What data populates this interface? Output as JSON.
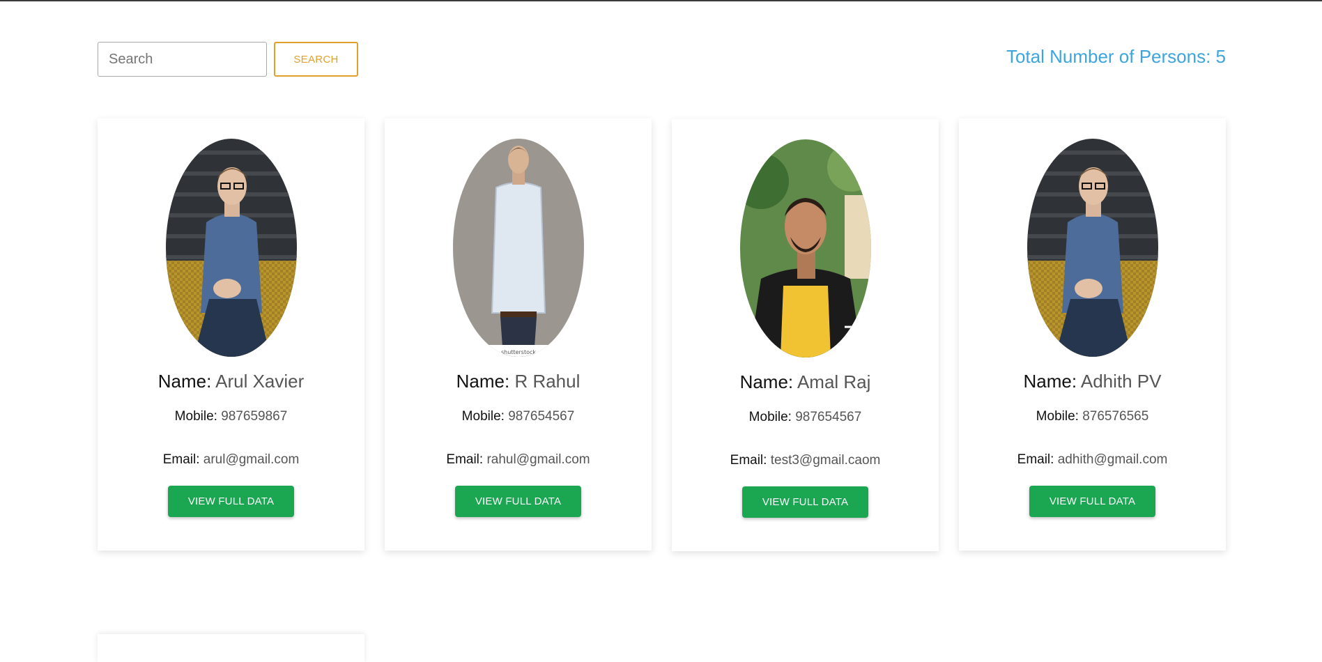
{
  "search": {
    "placeholder": "Search",
    "value": "",
    "button_label": "SEARCH"
  },
  "summary": {
    "total_label": "Total Number of Persons: 5"
  },
  "colors": {
    "accent_orange": "#e0a02a",
    "accent_blue": "#3da5de",
    "button_green": "#1ba651"
  },
  "field_labels": {
    "name": "Name:",
    "mobile": "Mobile:",
    "email": "Email:"
  },
  "persons": [
    {
      "name": "Arul Xavier",
      "mobile": "987659867",
      "email": "arul@gmail.com",
      "button_label": "VIEW FULL DATA",
      "photo": "man-glasses-blue-shirt-photo"
    },
    {
      "name": "R Rahul",
      "mobile": "987654567",
      "email": "rahul@gmail.com",
      "button_label": "VIEW FULL DATA",
      "photo": "man-white-shirt-standing-photo"
    },
    {
      "name": "Amal Raj",
      "mobile": "987654567",
      "email": "test3@gmail.caom",
      "button_label": "VIEW FULL DATA",
      "photo": "man-yellow-hoodie-photo"
    },
    {
      "name": "Adhith PV",
      "mobile": "876576565",
      "email": "adhith@gmail.com",
      "button_label": "VIEW FULL DATA",
      "photo": "man-glasses-blue-shirt-photo"
    }
  ]
}
